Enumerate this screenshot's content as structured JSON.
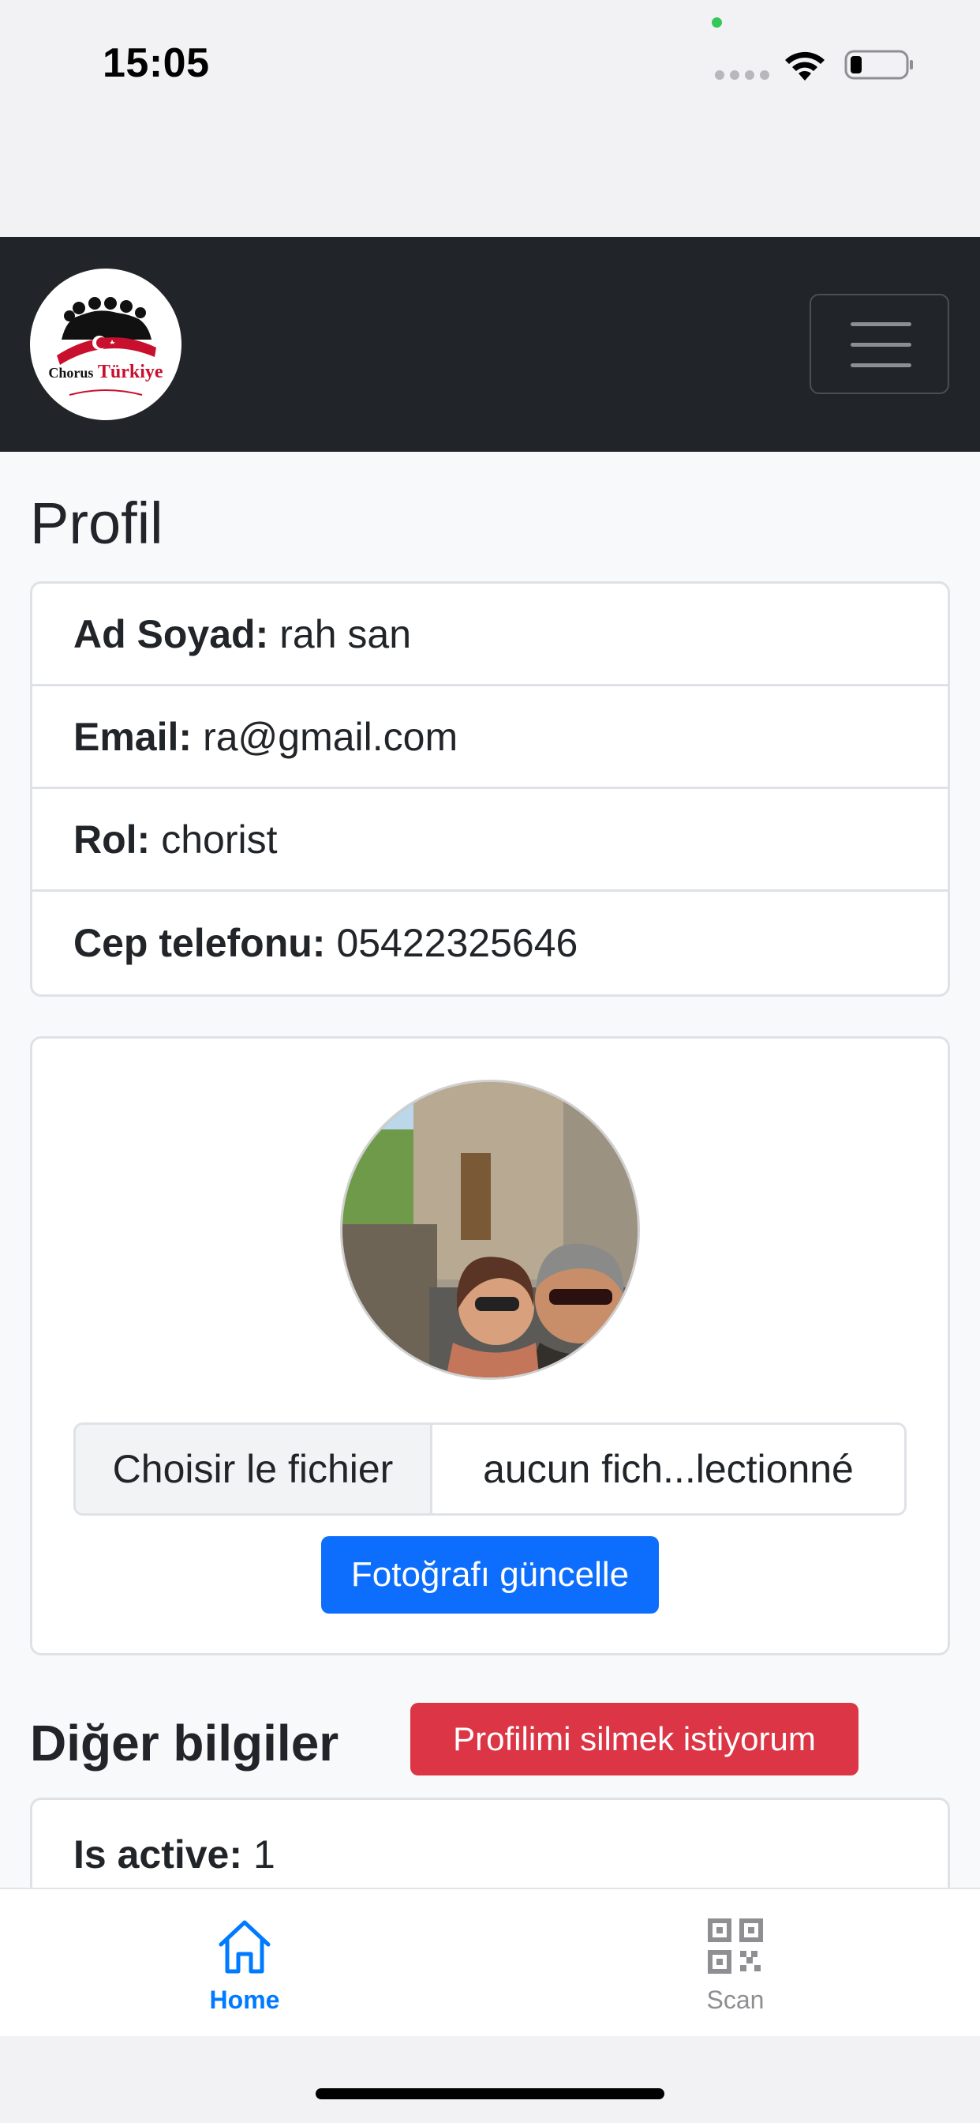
{
  "status_bar": {
    "time": "15:05"
  },
  "navbar": {
    "logo_line1": "Chorus",
    "logo_line2": "Türkiye"
  },
  "page": {
    "title": "Profil"
  },
  "profile": [
    {
      "label": "Ad Soyad:",
      "value": "rah san"
    },
    {
      "label": "Email:",
      "value": "ra@gmail.com"
    },
    {
      "label": "Rol:",
      "value": "chorist"
    },
    {
      "label": "Cep telefonu:",
      "value": "05422325646"
    }
  ],
  "photo": {
    "file_button": "Choisir le fichier",
    "file_name": "aucun fich...lectionné",
    "update_button": "Fotoğrafı güncelle"
  },
  "other": {
    "title": "Diğer bilgiler",
    "delete_button": "Profilimi silmek istiyorum",
    "items": [
      {
        "label": "Is active:",
        "value": "1"
      }
    ]
  },
  "tabbar": {
    "home_label": "Home",
    "scan_label": "Scan",
    "active_color": "#007aff",
    "inactive_color": "#8e8e93"
  }
}
